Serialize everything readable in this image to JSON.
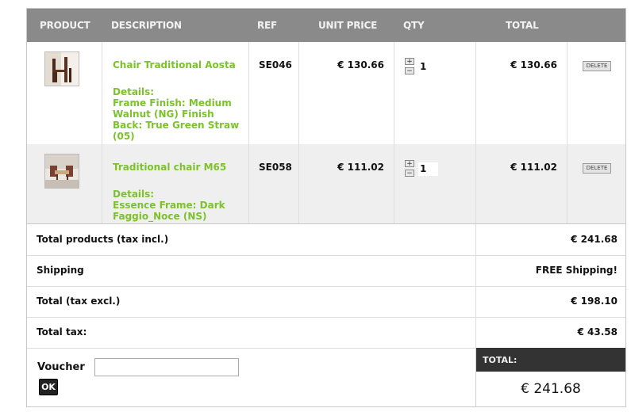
{
  "header": {
    "product": "PRODUCT",
    "description": "DESCRIPTION",
    "ref": "REF",
    "unit_price": "UNIT PRICE",
    "qty": "QTY",
    "total": "TOTAL"
  },
  "items": [
    {
      "name": "Chair Traditional Aosta",
      "details": "Details:\nFrame Finish: Medium Walnut (NG) Finish Back: True Green Straw (05)",
      "ref": "SE046",
      "unit_price": "€ 130.66",
      "qty": "1",
      "total": "€ 130.66",
      "delete_label": "DELETE",
      "plus": "+",
      "minus": "−"
    },
    {
      "name": "Traditional chair M65",
      "details": "Details:\nEssence Frame: Dark Faggio_Noce (NS)",
      "ref": "SE058",
      "unit_price": "€ 111.02",
      "qty": "1",
      "total": "€ 111.02",
      "delete_label": "DELETE",
      "plus": "+",
      "minus": "−"
    }
  ],
  "summary": [
    {
      "label": "Total products (tax incl.)",
      "value": "€ 241.68"
    },
    {
      "label": "Shipping",
      "value": "FREE Shipping!"
    },
    {
      "label": "Total (tax excl.)",
      "value": "€ 198.10"
    },
    {
      "label": "Total tax:",
      "value": "€ 43.58"
    }
  ],
  "voucher": {
    "label": "Voucher",
    "value": "",
    "ok_label": "OK"
  },
  "grand_total": {
    "label": "TOTAL:",
    "value": "€ 241.68"
  },
  "colors": {
    "header_bg": "#8a8a8a",
    "product_link": "#7cc22a",
    "total_box_bg": "#333333"
  }
}
